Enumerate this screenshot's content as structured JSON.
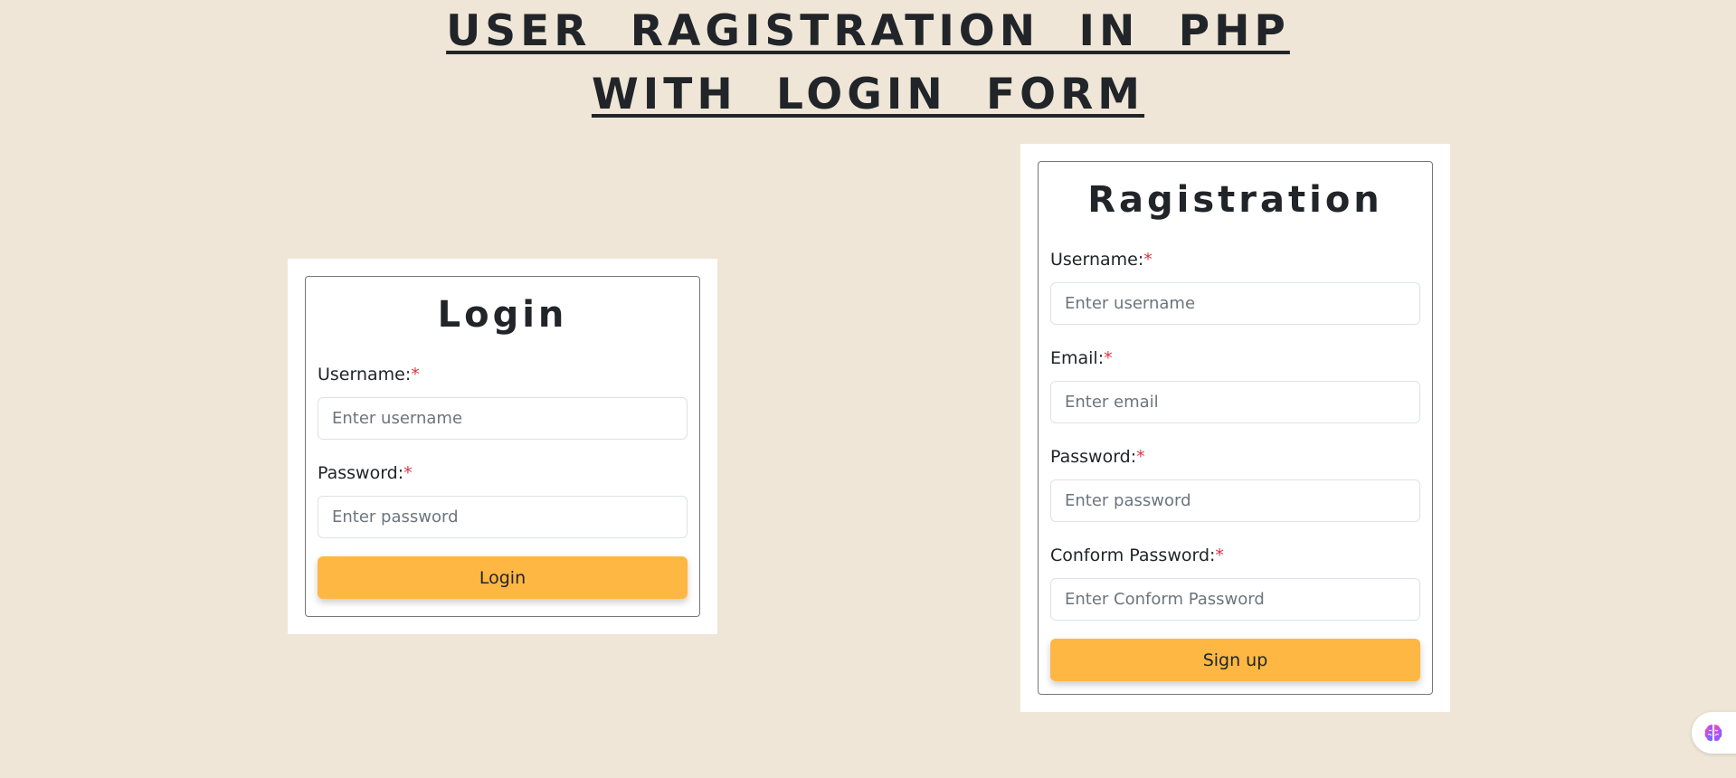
{
  "title": {
    "line1": "USER RAGISTRATION IN PHP",
    "line2": "WITH LOGIN FORM"
  },
  "login": {
    "heading": "Login",
    "username_label": "Username:",
    "username_placeholder": "Enter username",
    "password_label": "Password:",
    "password_placeholder": "Enter password",
    "submit_label": "Login"
  },
  "registration": {
    "heading": "Ragistration",
    "username_label": "Username:",
    "username_placeholder": "Enter username",
    "email_label": "Email:",
    "email_placeholder": "Enter email",
    "password_label": "Password:",
    "password_placeholder": "Enter password",
    "confirm_label": "Conform Password:",
    "confirm_placeholder": "Enter Conform Password",
    "submit_label": "Sign up"
  },
  "required_marker": "*",
  "widget": {
    "icon": "brain-icon"
  },
  "colors": {
    "background": "#efe6d7",
    "button": "#ffb744",
    "required": "#dc3545"
  }
}
